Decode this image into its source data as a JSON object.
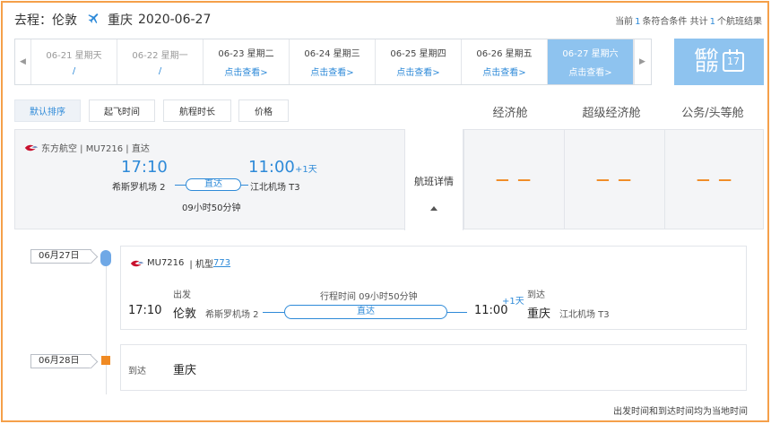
{
  "header": {
    "label": "去程：伦敦",
    "destination": "重庆",
    "date": "2020-06-27",
    "result_prefix": "当前",
    "result_count": "1",
    "result_middle": "条符合条件 共计",
    "result_total": "1",
    "result_suffix": "个航班结果"
  },
  "date_strip": {
    "days": [
      {
        "line1": "06-21 星期天",
        "line2": "/"
      },
      {
        "line1": "06-22 星期一",
        "line2": "/"
      },
      {
        "line1": "06-23 星期二",
        "line2": "点击查看>"
      },
      {
        "line1": "06-24 星期三",
        "line2": "点击查看>"
      },
      {
        "line1": "06-25 星期四",
        "line2": "点击查看>"
      },
      {
        "line1": "06-26 星期五",
        "line2": "点击查看>"
      },
      {
        "line1": "06-27 星期六",
        "line2": "点击查看>"
      }
    ],
    "low_price_calendar": "低价日历",
    "calendar_day": "17"
  },
  "sort": {
    "default": "默认排序",
    "departure_time": "起飞时间",
    "duration": "航程时长",
    "price": "价格"
  },
  "cabins": {
    "economy": "经济舱",
    "premium_economy": "超级经济舱",
    "business_first": "公务/头等舱"
  },
  "flight": {
    "airline_line": "东方航空 | MU7216 | 直达",
    "dep_time": "17:10",
    "arr_time": "11:00",
    "plus_day": "+1天",
    "dep_airport": "希斯罗机场 2",
    "arr_airport": "江北机场 T3",
    "direct": "直达",
    "duration": "09小时50分钟",
    "detail": "航班详情",
    "prices": [
      "— —",
      "— —",
      "— —"
    ]
  },
  "detail": {
    "date1": "06月27日",
    "date2": "06月28日",
    "flight_no": "MU7216",
    "model_label": "| 机型",
    "model": "773",
    "depart_label": "出发",
    "arrive_label": "到达",
    "trip_time": "行程时间 09小时50分钟",
    "plus_day": "+1天",
    "dep_time": "17:10",
    "dep_city": "伦敦",
    "dep_airport": "希斯罗机场 2",
    "direct": "直达",
    "arr_time": "11:00",
    "arr_city": "重庆",
    "arr_airport": "江北机场 T3",
    "arrive_label2": "到达",
    "final_city": "重庆"
  },
  "footer": "出发时间和到达时间均为当地时间",
  "colors": {
    "accent": "#2e8ad8",
    "active_day": "#8ec3ef",
    "price": "#f08a23",
    "frame": "#f5a04a"
  }
}
